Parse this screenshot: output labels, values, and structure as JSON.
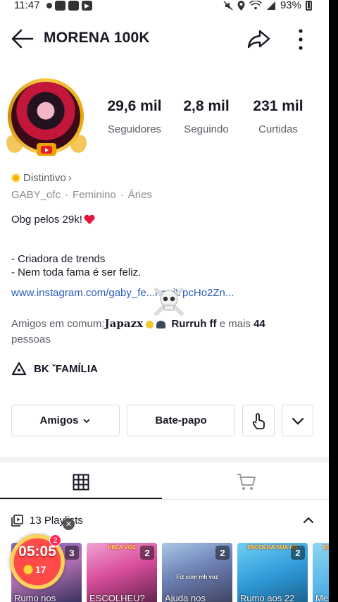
{
  "status_bar": {
    "time": "11:47",
    "battery": "93%"
  },
  "header": {
    "title": "MORENA 100K"
  },
  "stats": [
    {
      "value": "29,6 mil",
      "label": "Seguidores"
    },
    {
      "value": "2,8 mil",
      "label": "Seguindo"
    },
    {
      "value": "231 mil",
      "label": "Curtidas"
    }
  ],
  "badge": {
    "label": "Distintivo",
    "chevron": "›"
  },
  "meta": {
    "username": "GABY_ofc",
    "gender": "Feminino",
    "sign": "Áries",
    "separator": "·"
  },
  "bio": {
    "line1": "Obg pelos 29k!",
    "line2": "- Criadora de trends",
    "line3": "- Nem toda fama é ser feliz.",
    "link": "www.instagram.com/gaby_fe...h=ejVpcHo2Zn..."
  },
  "friends": {
    "prefix": "Amigos em comum:",
    "name1": "Japazx",
    "name2": "Rurruh ff",
    "middle": " e mais ",
    "count": "44",
    "suffix": "pessoas"
  },
  "group": {
    "label": "BK ˇFAMÍLIA"
  },
  "buttons": {
    "friends": "Amigos",
    "chat": "Bate-papo"
  },
  "playlists": {
    "title": "13 Playlists"
  },
  "cards": [
    {
      "count": "3",
      "caption": "Rumo nos",
      "top": ""
    },
    {
      "count": "2",
      "caption": "ESCOLHEU?",
      "top": "PELA VOZ"
    },
    {
      "count": "2",
      "caption": "Ajuda nos",
      "top": "Fiz com mh voz"
    },
    {
      "count": "2",
      "caption": "Rumo aos 22",
      "top": "ESCOLHA SUA AG"
    },
    {
      "count": "",
      "caption": "Me",
      "top": "ES"
    }
  ],
  "timer": {
    "time": "05:05",
    "coins": "17",
    "badge": "2"
  },
  "colors": {
    "accent": "#fe2c55",
    "link": "#2b5db9",
    "text": "#161823",
    "muted": "#8a8b91"
  }
}
